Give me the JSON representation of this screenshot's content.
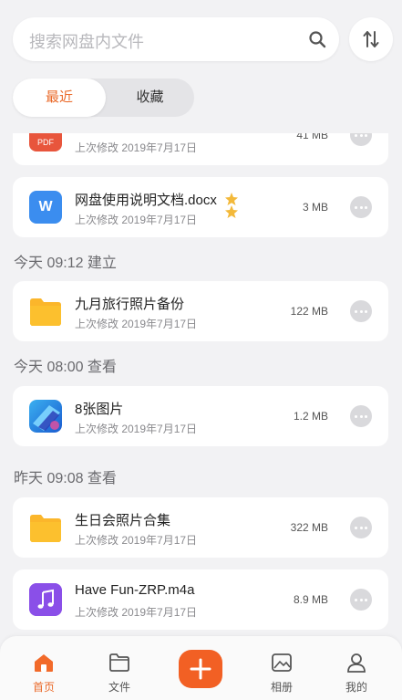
{
  "search": {
    "placeholder": "搜索网盘内文件"
  },
  "tabs": [
    {
      "label": "最近",
      "active": true
    },
    {
      "label": "收藏",
      "active": false
    }
  ],
  "cards": [
    {
      "type": "pdf",
      "icon": "pdf-icon",
      "icon_text": "PDF",
      "name": "",
      "meta": "上次修改 2019年7月17日",
      "size": "41 MB"
    },
    {
      "type": "word",
      "icon": "word-doc-icon",
      "icon_text": "W",
      "name": "网盘使用说明文档.docx",
      "meta": "上次修改 2019年7月17日",
      "size": "3 MB",
      "starred": true
    },
    {
      "type": "folder",
      "icon": "folder-icon",
      "name": "九月旅行照片备份",
      "meta": "上次修改 2019年7月17日",
      "size": "122 MB"
    },
    {
      "type": "image",
      "icon": "image-thumbnail-icon",
      "name": "8张图片",
      "meta": "上次修改 2019年7月17日",
      "size": "1.2 MB"
    },
    {
      "type": "folder",
      "icon": "folder-icon",
      "name": "生日会照片合集",
      "meta": "上次修改 2019年7月17日",
      "size": "322 MB"
    },
    {
      "type": "audio",
      "icon": "music-note-icon",
      "name": "Have Fun-ZRP.m4a",
      "meta": "上次修改 2019年7月17日",
      "size": "8.9 MB"
    }
  ],
  "groups": [
    "今天 09:12 建立",
    "今天 08:00 查看",
    "昨天 09:08 查看"
  ],
  "nav": [
    {
      "label": "首页",
      "icon": "home-icon",
      "active": true
    },
    {
      "label": "文件",
      "icon": "folder-outline-icon",
      "active": false
    },
    {
      "label": "",
      "icon": "plus-icon",
      "active": false
    },
    {
      "label": "相册",
      "icon": "photo-album-icon",
      "active": false
    },
    {
      "label": "我的",
      "icon": "profile-icon",
      "active": false
    }
  ],
  "colors": {
    "accent": "#ea6a2a",
    "fab": "#f26024",
    "background": "#f2f2f4"
  }
}
